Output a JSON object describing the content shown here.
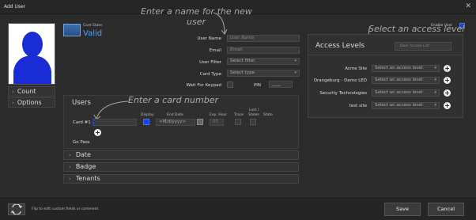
{
  "window": {
    "title": "Add User",
    "close_glyph": "✕"
  },
  "side": {
    "count_label": "Count",
    "options_label": "Options"
  },
  "card_state": {
    "label": "Card State:",
    "value": "Valid"
  },
  "form": {
    "user_name_label": "User Name",
    "user_name_placeholder": "User Name",
    "email_label": "Email",
    "email_placeholder": "Email",
    "user_filter_label": "User Filter",
    "user_filter_value": "Select filter",
    "card_type_label": "Card Type",
    "card_type_value": "Select type",
    "wait_keypad_label": "Wait For Keypad",
    "pin_label": "PIN",
    "pin_value": "____"
  },
  "annotations": {
    "enter_name_1": "Enter a name for the new",
    "enter_name_2": "user",
    "enter_card": "Enter a card number",
    "select_access": "Select an access level"
  },
  "users_section": {
    "title": "Users",
    "col_display": "Display",
    "col_end_date": "End Date",
    "col_exp_hour": "Exp. Hour",
    "col_trace": "Trace",
    "col_lost_stolen_1": "Lost /",
    "col_lost_stolen_2": "Stolen",
    "col_state": "State",
    "card_label": "Card #1",
    "end_date_value": "<M/d/yyyy>",
    "exp_hour_value": "00",
    "go_pass_label": "Go Pass",
    "plus_glyph": "+"
  },
  "collapsibles": {
    "date": "Date",
    "badge": "Badge",
    "tenants": "Tenants",
    "chevron": "›"
  },
  "access": {
    "enable_user_label": "Enable User",
    "title": "Access Levels",
    "door_list_label": "Door Access List",
    "placeholder": "Select an access level",
    "rows": [
      {
        "site": "Acme Site"
      },
      {
        "site": "Orangeburg - Demo LED"
      },
      {
        "site": "Security Technologies"
      },
      {
        "site": "test site"
      }
    ]
  },
  "bottom": {
    "flip_hint": "Flip to edit custom fields or comment",
    "save_label": "Save",
    "cancel_label": "Cancel"
  },
  "colors": {
    "accent": "#4aa3ff",
    "check_blue": "#1f3fe0",
    "avatar_blue": "#1a2cd6"
  }
}
